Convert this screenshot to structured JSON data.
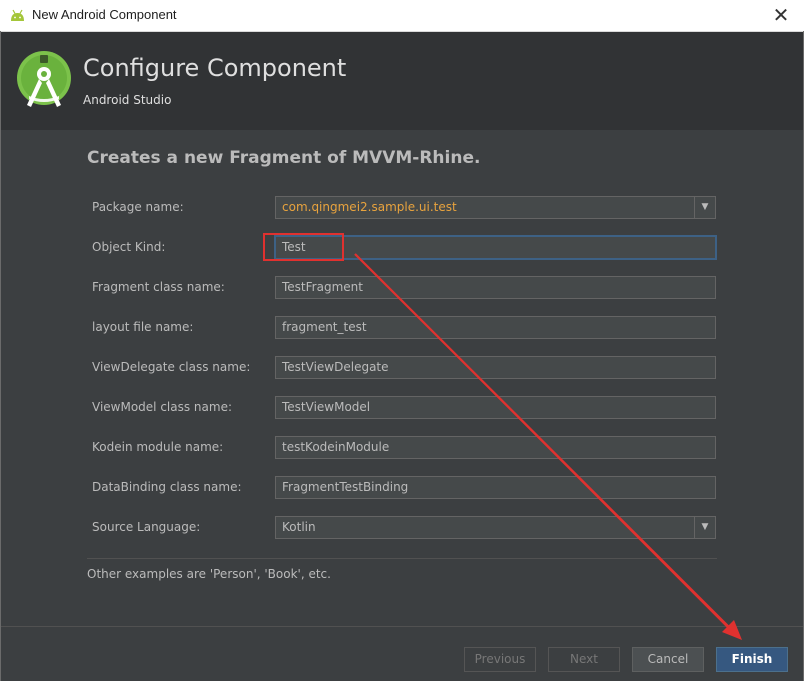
{
  "window": {
    "title": "New Android Component",
    "close_glyph": "✕"
  },
  "header": {
    "title": "Configure Component",
    "subtitle": "Android Studio"
  },
  "form": {
    "description": "Creates a new Fragment of MVVM-Rhine.",
    "fields": [
      {
        "label": "Package name:",
        "value": "com.qingmei2.sample.ui.test",
        "type": "combo"
      },
      {
        "label": "Object Kind:",
        "value": "Test",
        "type": "text",
        "focused": true
      },
      {
        "label": "Fragment class name:",
        "value": "TestFragment",
        "type": "text"
      },
      {
        "label": "layout file name:",
        "value": "fragment_test",
        "type": "text"
      },
      {
        "label": "ViewDelegate class name:",
        "value": "TestViewDelegate",
        "type": "text"
      },
      {
        "label": "ViewModel class name:",
        "value": "TestViewModel",
        "type": "text"
      },
      {
        "label": "Kodein module name:",
        "value": "testKodeinModule",
        "type": "text"
      },
      {
        "label": "DataBinding class name:",
        "value": "FragmentTestBinding",
        "type": "text"
      },
      {
        "label": "Source Language:",
        "value": "Kotlin",
        "type": "combo"
      }
    ],
    "hint": "Other examples are 'Person', 'Book', etc."
  },
  "footer": {
    "previous_label": "Previous",
    "next_label": "Next",
    "cancel_label": "Cancel",
    "finish_label": "Finish"
  },
  "colors": {
    "dialog_bg": "#3c3f41",
    "header_bg": "#313335",
    "annotation_red": "#e0312f",
    "package_value": "#e8a33e",
    "primary_button": "#365880"
  },
  "icons": {
    "app_icon": "android-icon",
    "logo": "android-studio-logo-icon",
    "combo_arrow": "chevron-down-icon"
  }
}
